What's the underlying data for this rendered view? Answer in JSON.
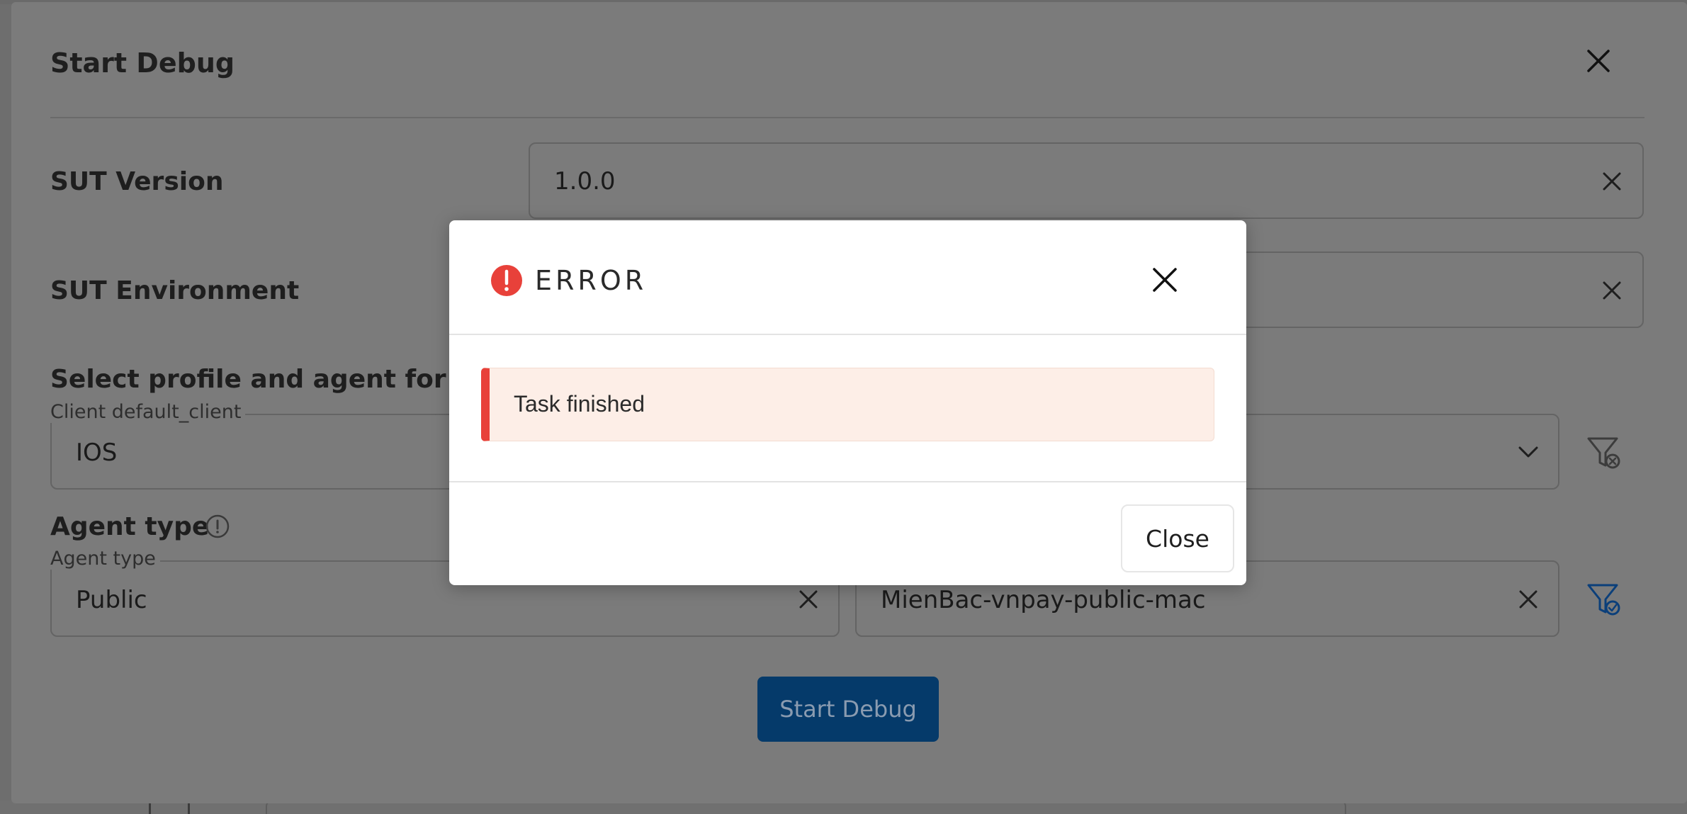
{
  "dialog": {
    "title": "Start Debug",
    "sut_version": {
      "label": "SUT Version",
      "value": "1.0.0"
    },
    "sut_environment": {
      "label": "SUT Environment",
      "value": ""
    },
    "profile_section": {
      "heading": "Select profile and agent for the",
      "client_legend": "Client default_client",
      "client_value": "IOS"
    },
    "agent_type": {
      "label": "Agent type",
      "legend": "Agent type",
      "value": "Public",
      "agent_value": "MienBac-vnpay-public-mac"
    },
    "start_button": "Start Debug"
  },
  "error_modal": {
    "title": "ERROR",
    "message": "Task finished",
    "close_button": "Close"
  },
  "colors": {
    "overlay_background": "#7b7b7b",
    "error_red": "#e8413a",
    "alert_background": "#fdeee7",
    "primary_button": "#053a6a"
  },
  "icons": [
    "close-icon",
    "error-icon",
    "info-icon",
    "chevron-down-icon",
    "filter-clear-icon",
    "filter-check-icon"
  ]
}
